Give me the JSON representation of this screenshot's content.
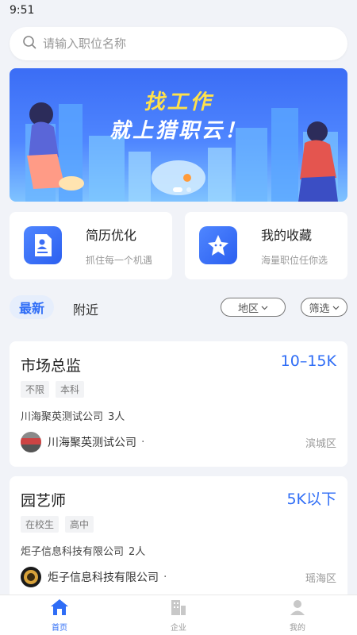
{
  "status_bar": {
    "time": "9:51"
  },
  "search": {
    "placeholder": "请输入职位名称",
    "icon": "search-icon"
  },
  "banner": {
    "line1": "找工作",
    "line2": "就上猎职云！"
  },
  "features": [
    {
      "title": "简历优化",
      "subtitle": "抓住每一个机遇",
      "icon": "resume-icon"
    },
    {
      "title": "我的收藏",
      "subtitle": "海量职位任你选",
      "icon": "star-icon"
    }
  ],
  "tabs": {
    "latest": "最新",
    "nearby": "附近",
    "region": "地区",
    "filter": "筛选"
  },
  "jobs": [
    {
      "title": "市场总监",
      "salary": "10–15K",
      "tags": [
        "不限",
        "本科"
      ],
      "company": "川海聚英测试公司",
      "count": "3人",
      "poster": "川海聚英测试公司",
      "district": "滨城区"
    },
    {
      "title": "园艺师",
      "salary": "5K以下",
      "tags": [
        "在校生",
        "高中"
      ],
      "company": "炬子信息科技有限公司",
      "count": "2人",
      "poster": "炬子信息科技有限公司",
      "district": "瑶海区"
    }
  ],
  "nav": [
    {
      "label": "首页",
      "icon": "home-icon",
      "active": true
    },
    {
      "label": "企业",
      "icon": "building-icon",
      "active": false
    },
    {
      "label": "我的",
      "icon": "user-icon",
      "active": false
    }
  ],
  "colors": {
    "accent": "#2f6df6",
    "background": "#f1f3f8",
    "banner_yellow": "#ffe14b"
  }
}
